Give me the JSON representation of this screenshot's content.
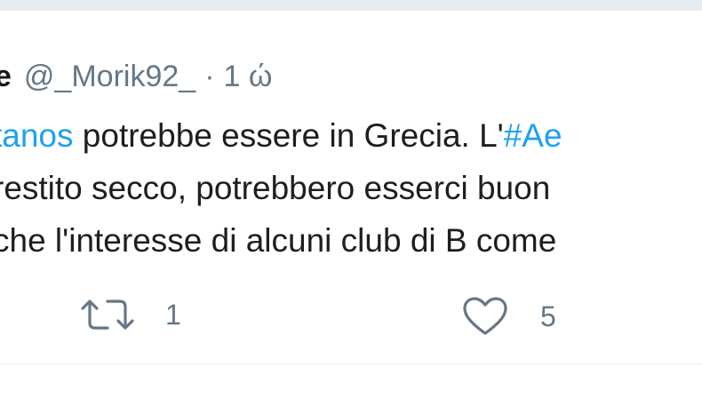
{
  "tweet": {
    "author_name_fragment": "e",
    "handle": "@_Morik92_",
    "separator": "·",
    "time": "1 ώ",
    "lines": [
      {
        "link_text": "tanos",
        "text": " potrebbe essere in Grecia. L'",
        "link2": "#Ae"
      },
      {
        "text": "restito secco, potrebbero esserci buon"
      },
      {
        "text": "che l'interesse di alcuni club di B come"
      }
    ],
    "actions": {
      "retweet_icon": "retweet-icon",
      "retweet_count": "1",
      "like_icon": "heart-icon",
      "like_count": "5"
    }
  },
  "colors": {
    "link": "#1da1f2",
    "muted": "#657786",
    "text": "#14171a",
    "border": "#e6ecf0"
  }
}
